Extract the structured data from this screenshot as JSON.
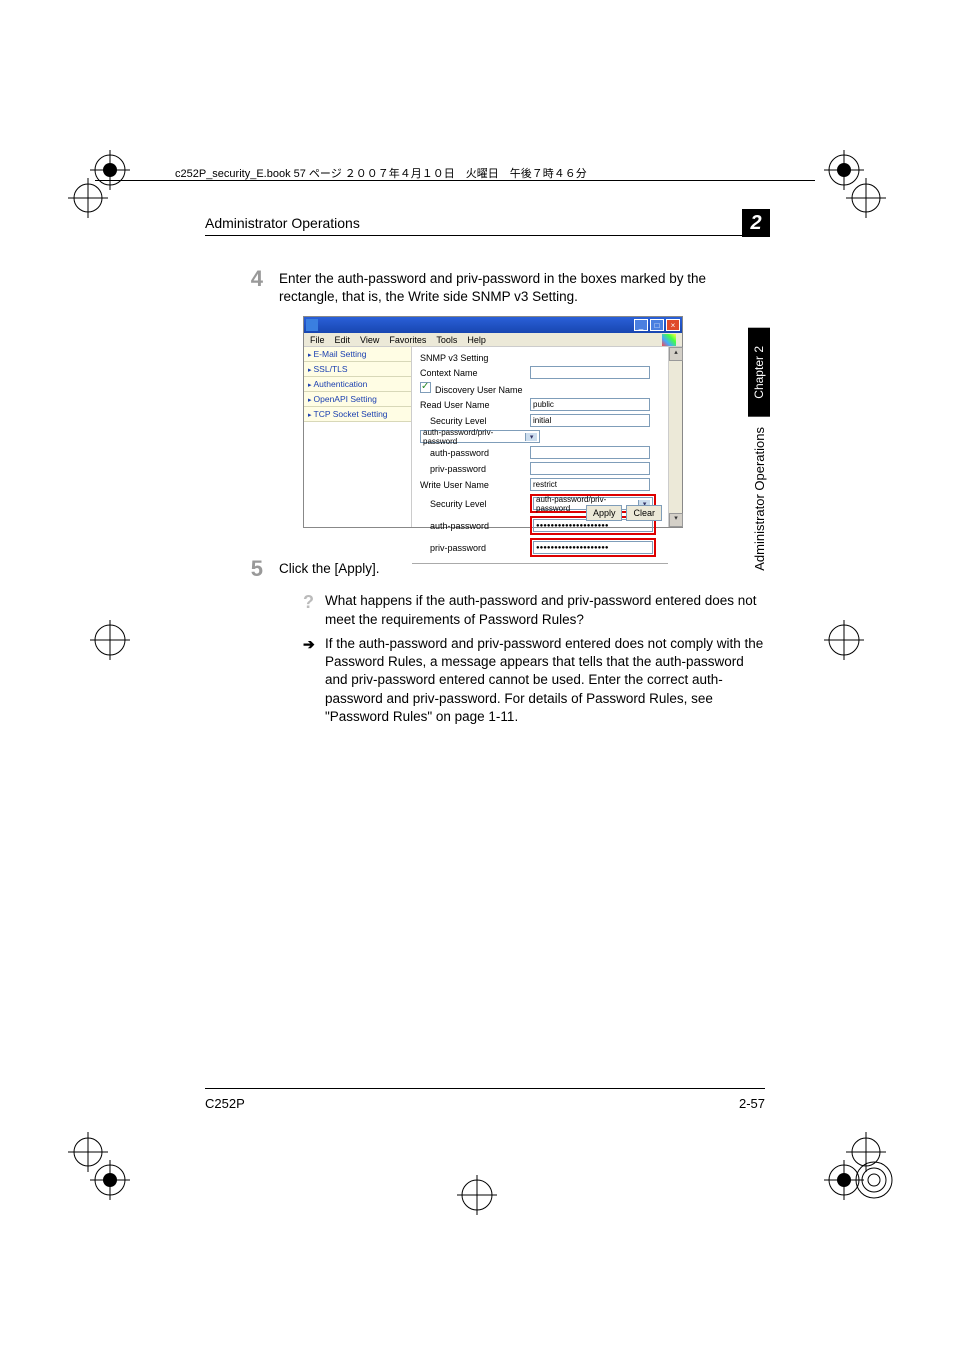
{
  "header_strip": "c252P_security_E.book  57 ページ  ２００７年４月１０日　火曜日　午後７時４６分",
  "page_title": "Administrator Operations",
  "chapter_num": "2",
  "step4": {
    "num": "4",
    "text": "Enter the auth-password and priv-password in the boxes marked by the rectangle, that is, the Write side SNMP v3 Setting."
  },
  "shot": {
    "menubar": [
      "File",
      "Edit",
      "View",
      "Favorites",
      "Tools",
      "Help"
    ],
    "sidebar": [
      "E-Mail Setting",
      "SSL/TLS",
      "Authentication",
      "OpenAPI Setting",
      "TCP Socket Setting"
    ],
    "form": {
      "title": "SNMP v3 Setting",
      "context_name": "Context Name",
      "discovery_user": "Discovery User Name",
      "read_user": "Read User Name",
      "read_user_val": "public",
      "sec_level": "Security Level",
      "sec_level_val": "auth-password/priv-password",
      "auth_pw": "auth-password",
      "priv_pw": "priv-password",
      "initial": "initial",
      "write_user": "Write User Name",
      "write_user_val": "restrict",
      "sec_level2_val": "auth-password/priv-password",
      "dots": "●●●●●●●●●●●●●●●●●●●●"
    },
    "buttons": {
      "apply": "Apply",
      "clear": "Clear"
    }
  },
  "step5": {
    "num": "5",
    "text": "Click the [Apply]."
  },
  "qa": {
    "q": "What happens if the auth-password and priv-password entered does not meet the requirements of Password Rules?",
    "a": "If the auth-password and priv-password entered does not comply with the Password Rules, a message appears that tells that the auth-password and priv-password entered cannot be used. Enter the correct auth-password and priv-password. For details of Password Rules, see \"Password Rules\" on page 1-11."
  },
  "side_tab_chapter": "Chapter 2",
  "side_tab_label": "Administrator Operations",
  "footer_left": "C252P",
  "footer_right": "2-57"
}
